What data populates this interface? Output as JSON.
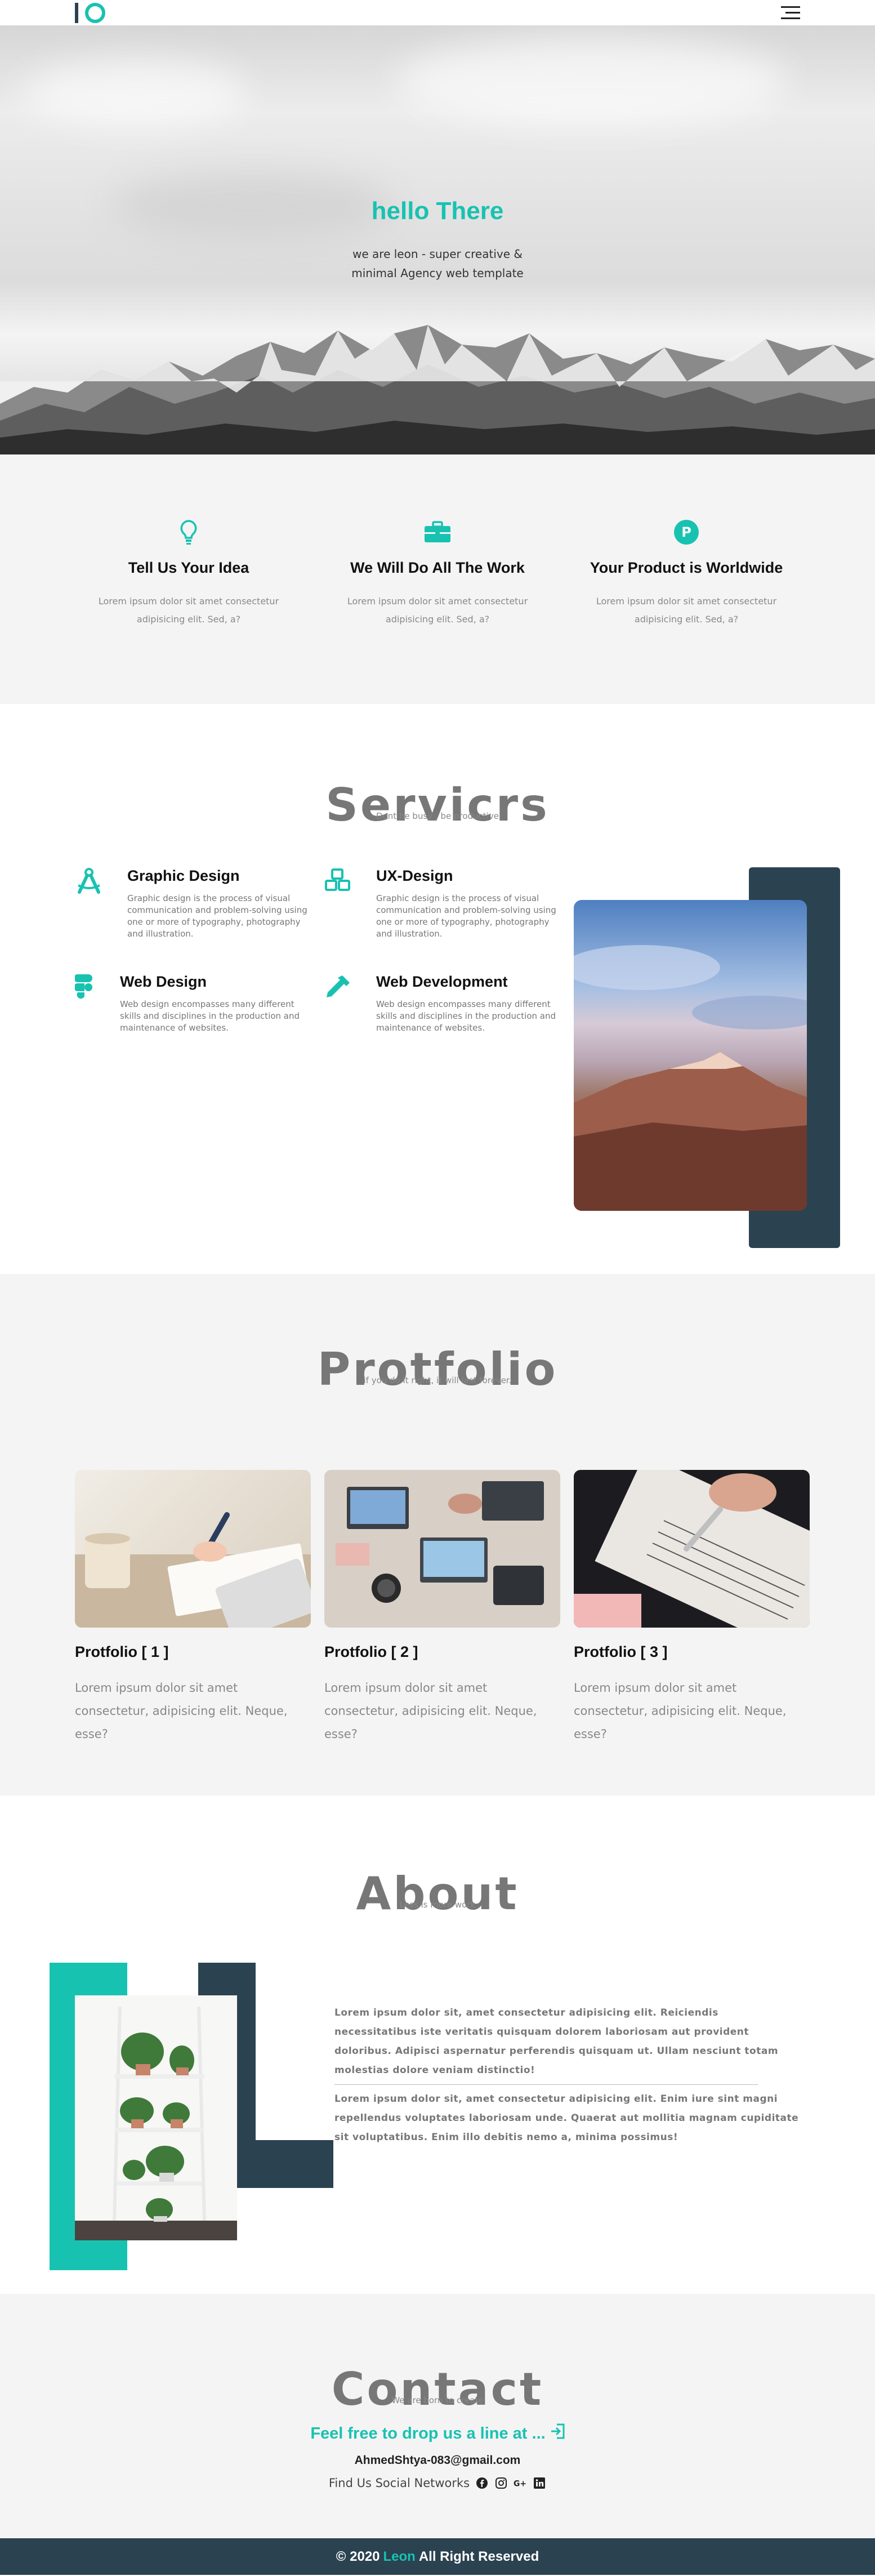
{
  "nav": {
    "menu_icon": "hamburger-menu-icon"
  },
  "hero": {
    "title": "hello There",
    "subtitle": "we are leon - super creative & minimal Agency web template"
  },
  "features": [
    {
      "icon": "lightbulb-icon",
      "title": "Tell Us Your Idea",
      "text": "Lorem ipsum dolor sit amet consectetur adipisicing elit. Sed, a?"
    },
    {
      "icon": "briefcase-icon",
      "title": "We Will Do All The Work",
      "text": "Lorem ipsum dolor sit amet consectetur adipisicing elit. Sed, a?"
    },
    {
      "icon": "product-p-icon",
      "title": "Your Product is Worldwide",
      "text": "Lorem ipsum dolor sit amet consectetur adipisicing elit. Sed, a?"
    }
  ],
  "services": {
    "title": "Servicrs",
    "subtitle": "Dont be busy , be productive",
    "items": [
      {
        "icon": "compass-icon",
        "title": "Graphic Design",
        "text": "Graphic design is the process of visual communication and problem-solving using one or more of typography, photography and illustration."
      },
      {
        "icon": "cubes-icon",
        "title": "UX-Design",
        "text": "Graphic design is the process of visual communication and problem-solving using one or more of typography, photography and illustration."
      },
      {
        "icon": "figma-icon",
        "title": "Web Design",
        "text": "Web design encompasses many different skills and disciplines in the production and maintenance of websites."
      },
      {
        "icon": "eyedropper-icon",
        "title": "Web Development",
        "text": "Web design encompasses many different skills and disciplines in the production and maintenance of websites."
      }
    ]
  },
  "portfolio": {
    "title": "Protfolio",
    "subtitle": "if you do it right, it will last forever.",
    "items": [
      {
        "title": "Protfolio [ 1 ]",
        "text": "Lorem ipsum dolor sit amet consectetur, adipisicing elit. Neque, esse?"
      },
      {
        "title": "Protfolio [ 2 ]",
        "text": "Lorem ipsum dolor sit amet consectetur, adipisicing elit. Neque, esse?"
      },
      {
        "title": "Protfolio [ 3 ]",
        "text": "Lorem ipsum dolor sit amet consectetur, adipisicing elit. Neque, esse?"
      }
    ]
  },
  "about": {
    "title": "About",
    "subtitle": "Less is more work",
    "p1": "Lorem ipsum dolor sit, amet consectetur adipisicing elit. Reiciendis necessitatibus iste veritatis quisquam dolorem laboriosam aut provident doloribus. Adipisci aspernatur perferendis quisquam ut. Ullam nesciunt totam molestias dolore veniam distinctio!",
    "p2": "Lorem ipsum dolor sit, amet consectetur adipisicing elit. Enim iure sint magni repellendus voluptates laboriosam unde. Quaerat aut mollitia magnam cupiditate sit voluptatibus. Enim illo debitis nemo a, minima possimus!"
  },
  "contact": {
    "title": "Contact",
    "subtitle": "We are born to create",
    "line": "Feel free to drop us a line at ...",
    "email": "AhmedShtya-083@gmail.com",
    "social_label": "Find Us Social Networks",
    "social": [
      "facebook-icon",
      "instagram-icon",
      "google-plus-icon",
      "linkedin-icon"
    ]
  },
  "footer": {
    "prefix": "© 2020",
    "brand": "Leon",
    "suffix": "All Right Reserved"
  },
  "colors": {
    "accent": "#18c2b1",
    "navy": "#2b4250",
    "section_bg": "#f4f4f4"
  }
}
